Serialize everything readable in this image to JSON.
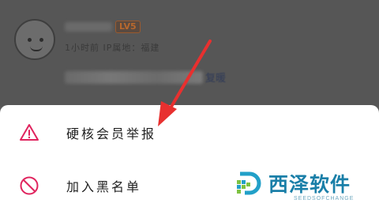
{
  "comment": {
    "level_badge": "LV5",
    "meta": "1小时前 IP属地：福建",
    "tail": "复暖"
  },
  "sheet": {
    "items": [
      {
        "label": "硬核会员举报",
        "icon": "warning-triangle-icon"
      },
      {
        "label": "加入黑名单",
        "icon": "block-icon"
      }
    ]
  },
  "watermark": {
    "title": "西泽软件",
    "subtitle": "SEEDSOFCHANGE"
  },
  "colors": {
    "accent_red": "#e0245e",
    "overlay": "#5b5b5b",
    "watermark_blue": "#1a7fa8"
  }
}
